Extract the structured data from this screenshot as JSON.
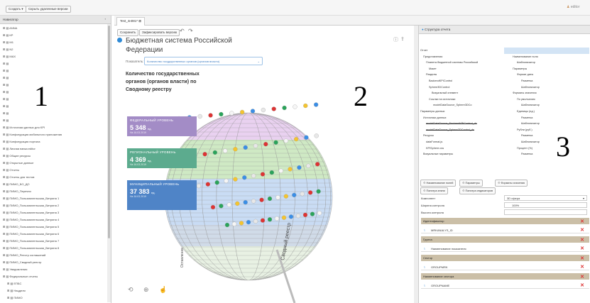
{
  "toolbar": {
    "create_label": "Создать",
    "hide_deleted_label": "Скрыть удаленные версии",
    "user_label": "editor"
  },
  "navigator": {
    "title": "Навигатор",
    "items": [
      "ANNA",
      "КР",
      "M1",
      "N2",
      "MAX",
      "",
      "",
      "",
      "",
      "",
      "",
      "",
      "",
      "",
      "Источники данных для KPI",
      "Конфигурация мобильного приложения",
      "Конфигурация портала",
      "Личная папка editor",
      "Общие ресурсы",
      "Открытые данные",
      "Отчеты",
      "Отчеты для тестов",
      "ПИМО_БО_ДО",
      "ПИМО_Перечни",
      "ПИМО_Пользовательская_Витрина 1",
      "ПИМО_Пользовательская_Витрина 2",
      "ПИМО_Пользовательская_Витрина 3",
      "ПИМО_Пользовательская_Витрина 4",
      "ПИМО_Пользовательская_Витрина 5",
      "ПИМО_Пользовательская_Витрина 6",
      "ПИМО_Пользовательская_Витрина 7",
      "ПИМО_Пользовательская_Витрина 8",
      "ПИМО_Реестр соглашений",
      "ПИМО_Сводный реестр",
      "Уведомления",
      "Федеральные отчеты",
      "ЕПБС",
      "Нацдели",
      "ПИМО"
    ]
  },
  "labels": {
    "one": "1",
    "two": "2",
    "three": "3"
  },
  "tab": {
    "name": "Test_4н081*",
    "close": "⊠"
  },
  "edit": {
    "save": "Сохранить",
    "fix": "Зафиксировать версию"
  },
  "report": {
    "title1": "Бюджетная система Российской",
    "title2": "Федерации",
    "indicator_label": "Показатель:",
    "indicator_value": "Количество государственных органов (органов власти)",
    "subtitle1": "Количество государственных",
    "subtitle2": "органов (органов власти) по",
    "subtitle3": "Сводному реестру"
  },
  "cards": [
    {
      "title": "ФЕДЕРАЛЬНЫЙ УРОВЕНЬ",
      "value": "5 348",
      "unit": "ед.",
      "date": "На 16.03.2019",
      "color": "#a38cc6"
    },
    {
      "title": "РЕГИОНАЛЬНЫЙ УРОВЕНЬ",
      "value": "4 369",
      "unit": "ед.",
      "date": "На 16.03.2019",
      "color": "#5cab8e"
    },
    {
      "title": "МУНИЦИПАЛЬНЫЙ УРОВЕНЬ",
      "value": "37 383",
      "unit": "ед.",
      "date": "На 16.03.2019",
      "color": "#4f84c7"
    }
  ],
  "sphere": {
    "label_registry": "Сводный реестр",
    "label_other": "Оставление"
  },
  "structure": {
    "title": "Структура отчета",
    "left": [
      "Отчет",
      "Представления",
      "Планета бюджетной системы Российской",
      "Макет",
      "Разделы",
      "BackendKPIControl",
      "Sphere3DControl",
      "Визуальный элемент",
      "Ссылки на источники",
      "modelDataSource_Sphere3DCo",
      "Параметры данных",
      "Источники данных",
      "modelDataSource_BackendKPIControl_ds",
      "modelDataSource_Sphere3DControl_ds",
      "Ресурсы",
      "dataFormat.js",
      "KPISphere.css",
      "Визуальные параметры"
    ],
    "right": [
      "Визуальный элемент",
      "Наименование поля",
      "Шаблонизатор",
      "Параметры",
      "Формат даты",
      "Разметка",
      "Шаблонизатор",
      "Форматы значения",
      "По умолчанию",
      "Шаблонизатор",
      "Единицы (ед.)",
      "Разметка",
      "Шаблонизатор",
      "Рубли (руб.)",
      "Разметка",
      "Шаблонизатор",
      "Процент (%)",
      "Разметка"
    ]
  },
  "props": {
    "tabs": [
      "Наименование полей",
      "Параметры",
      "Форматы значения",
      "Палитра зняни",
      "Палитра индикаторов"
    ],
    "component_label": "Компонент",
    "component_value": "3D сфера",
    "width_label": "Ширина контрола",
    "width_value": "100%",
    "height_label": "Высота контрола",
    "sections": [
      {
        "name": "Идентификатор",
        "value": "MRKANALYS_ID"
      },
      {
        "name": "Группа",
        "value": "Наименование показателя"
      },
      {
        "name": "Сектор",
        "value": "GROUPMRK"
      },
      {
        "name": "Наименование сектора",
        "value": "GROUPNAME"
      }
    ]
  }
}
